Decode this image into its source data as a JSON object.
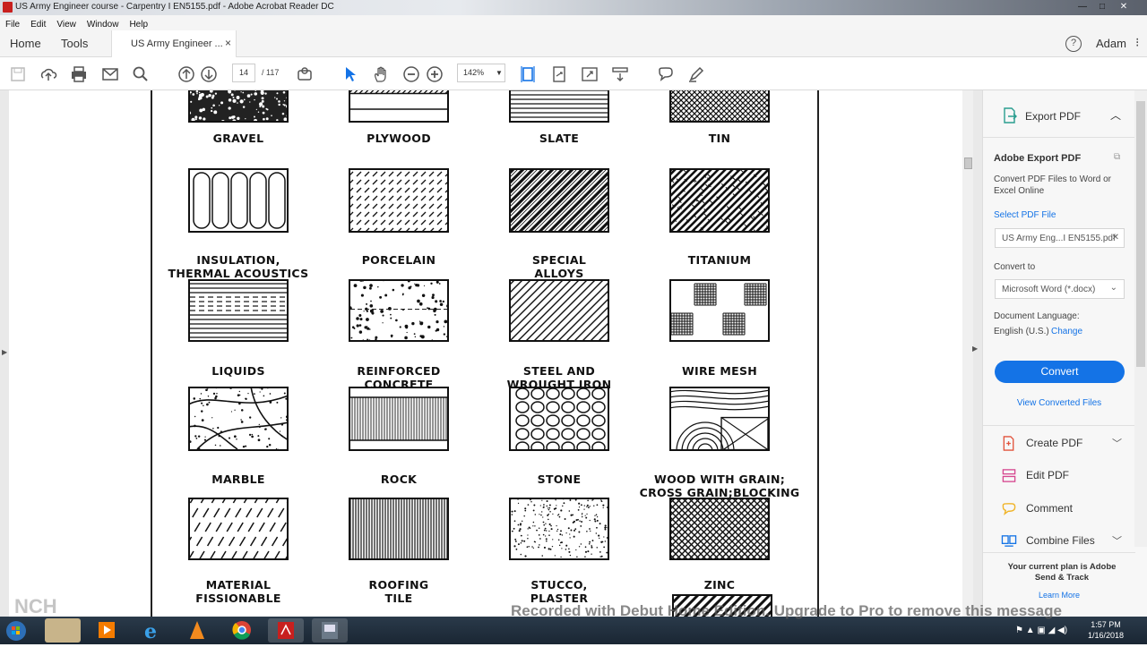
{
  "window": {
    "title": "US Army Engineer course - Carpentry I EN5155.pdf - Adobe Acrobat Reader DC",
    "minimize": "—",
    "maximize": "□",
    "close": "✕"
  },
  "menu": [
    "File",
    "Edit",
    "View",
    "Window",
    "Help"
  ],
  "tabs": {
    "home": "Home",
    "tools": "Tools",
    "document": "US Army Engineer ...",
    "close": "×"
  },
  "header_right": {
    "help": "?",
    "user": "Adam",
    "more": "⁝"
  },
  "toolbar": {
    "page_current": "14",
    "page_total": "/ 117",
    "zoom": "142%"
  },
  "materials": [
    {
      "label": "GRAVEL",
      "pattern": "gravel"
    },
    {
      "label": "PLYWOOD",
      "pattern": "plywood"
    },
    {
      "label": "SLATE",
      "pattern": "slate"
    },
    {
      "label": "TIN",
      "pattern": "tin"
    },
    {
      "label": "INSULATION,\nTHERMAL ACOUSTICS",
      "pattern": "insulation"
    },
    {
      "label": "PORCELAIN",
      "pattern": "porcelain"
    },
    {
      "label": "SPECIAL\nALLOYS",
      "pattern": "alloys"
    },
    {
      "label": "TITANIUM",
      "pattern": "titanium"
    },
    {
      "label": "LIQUIDS",
      "pattern": "liquids"
    },
    {
      "label": "REINFORCED\nCONCRETE",
      "pattern": "concrete"
    },
    {
      "label": "STEEL AND\nWROUGHT IRON",
      "pattern": "steel"
    },
    {
      "label": "WIRE MESH",
      "pattern": "wiremesh"
    },
    {
      "label": "MARBLE",
      "pattern": "marble"
    },
    {
      "label": "ROCK",
      "pattern": "rock"
    },
    {
      "label": "STONE",
      "pattern": "stone"
    },
    {
      "label": "WOOD WITH GRAIN;\nCROSS GRAIN;BLOCKING",
      "pattern": "wood"
    },
    {
      "label": "MATERIAL\nFISSIONABLE",
      "pattern": "fissionable"
    },
    {
      "label": "ROOFING\nTILE",
      "pattern": "roofing"
    },
    {
      "label": "STUCCO,\nPLASTER",
      "pattern": "stucco"
    },
    {
      "label": "ZINC",
      "pattern": "zinc"
    }
  ],
  "right_panel": {
    "export_title": "Export PDF",
    "section_title": "Adobe Export PDF",
    "description": "Convert PDF Files to Word or Excel Online",
    "select_label": "Select PDF File",
    "selected_file": "US Army Eng...I EN5155.pdf",
    "convert_to_label": "Convert to",
    "convert_to_value": "Microsoft Word (*.docx)",
    "language_label": "Document Language:",
    "language_value": "English (U.S.)",
    "change_link": "Change",
    "convert_button": "Convert",
    "view_converted": "View Converted Files",
    "tools": [
      "Create PDF",
      "Edit PDF",
      "Comment",
      "Combine Files"
    ],
    "plan_text": "Your current plan is Adobe Send & Track",
    "learn_more": "Learn More"
  },
  "watermark": "Recorded with Debut Home Edition. Upgrade to Pro to remove this message",
  "taskbar": {
    "time": "1:57 PM",
    "date": "1/16/2018"
  },
  "colors": {
    "accent": "#1473e6",
    "taskbar": "#1a2633"
  }
}
